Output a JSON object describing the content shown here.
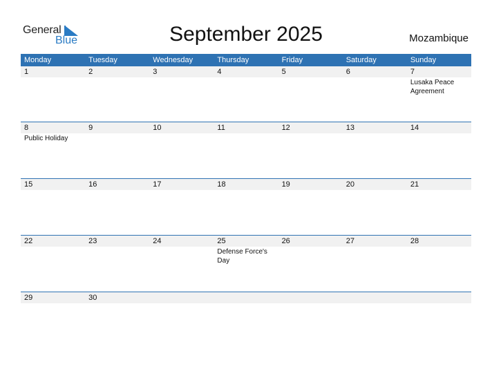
{
  "logo": {
    "general": "General",
    "blue": "Blue"
  },
  "title": "September 2025",
  "country": "Mozambique",
  "colors": {
    "header": "#2e72b3",
    "day_bg": "#f1f1f1",
    "logo_blue": "#2a7bc4"
  },
  "weekdays": [
    "Monday",
    "Tuesday",
    "Wednesday",
    "Thursday",
    "Friday",
    "Saturday",
    "Sunday"
  ],
  "weeks": [
    [
      {
        "day": "1",
        "event": ""
      },
      {
        "day": "2",
        "event": ""
      },
      {
        "day": "3",
        "event": ""
      },
      {
        "day": "4",
        "event": ""
      },
      {
        "day": "5",
        "event": ""
      },
      {
        "day": "6",
        "event": ""
      },
      {
        "day": "7",
        "event": "Lusaka Peace Agreement"
      }
    ],
    [
      {
        "day": "8",
        "event": "Public Holiday"
      },
      {
        "day": "9",
        "event": ""
      },
      {
        "day": "10",
        "event": ""
      },
      {
        "day": "11",
        "event": ""
      },
      {
        "day": "12",
        "event": ""
      },
      {
        "day": "13",
        "event": ""
      },
      {
        "day": "14",
        "event": ""
      }
    ],
    [
      {
        "day": "15",
        "event": ""
      },
      {
        "day": "16",
        "event": ""
      },
      {
        "day": "17",
        "event": ""
      },
      {
        "day": "18",
        "event": ""
      },
      {
        "day": "19",
        "event": ""
      },
      {
        "day": "20",
        "event": ""
      },
      {
        "day": "21",
        "event": ""
      }
    ],
    [
      {
        "day": "22",
        "event": ""
      },
      {
        "day": "23",
        "event": ""
      },
      {
        "day": "24",
        "event": ""
      },
      {
        "day": "25",
        "event": "Defense Force's Day"
      },
      {
        "day": "26",
        "event": ""
      },
      {
        "day": "27",
        "event": ""
      },
      {
        "day": "28",
        "event": ""
      }
    ],
    [
      {
        "day": "29",
        "event": ""
      },
      {
        "day": "30",
        "event": ""
      },
      {
        "day": "",
        "event": ""
      },
      {
        "day": "",
        "event": ""
      },
      {
        "day": "",
        "event": ""
      },
      {
        "day": "",
        "event": ""
      },
      {
        "day": "",
        "event": ""
      }
    ]
  ]
}
